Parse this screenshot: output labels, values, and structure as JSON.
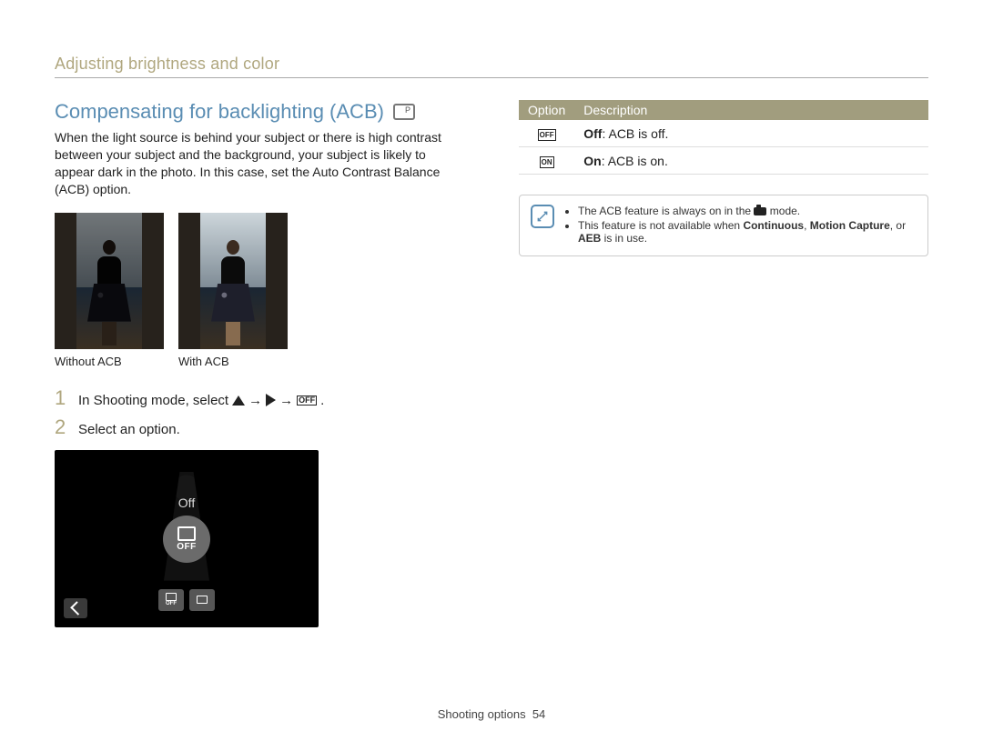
{
  "breadcrumb": "Adjusting brightness and color",
  "section_title": "Compensating for backlighting (ACB)",
  "intro": "When the light source is behind your subject or there is high contrast between your subject and the background, your subject is likely to appear dark in the photo. In this case, set the Auto Contrast Balance (ACB) option.",
  "photos": {
    "without_caption": "Without ACB",
    "with_caption": "With ACB"
  },
  "steps": {
    "s1_num": "1",
    "s1_prefix": "In Shooting mode, select ",
    "arrow": "→",
    "period": ".",
    "s2_num": "2",
    "s2_text": "Select an option."
  },
  "screen": {
    "off_label": "Off",
    "big_off": "OFF",
    "small_off": "OFF",
    "small_on": "ON"
  },
  "table": {
    "h_option": "Option",
    "h_desc": "Description",
    "row1_bold": "Off",
    "row1_rest": ": ACB is off.",
    "row2_bold": "On",
    "row2_rest": ": ACB is on."
  },
  "notes": {
    "n1_prefix": "The ACB feature is always on in the ",
    "n1_suffix": " mode.",
    "n2_prefix": "This feature is not available when ",
    "n2_b1": "Continuous",
    "n2_s1": ", ",
    "n2_b2": "Motion Capture",
    "n2_s2": ", or ",
    "n2_b3": "AEB",
    "n2_suffix": " is in use."
  },
  "footer": {
    "label": "Shooting options",
    "page": "54"
  }
}
